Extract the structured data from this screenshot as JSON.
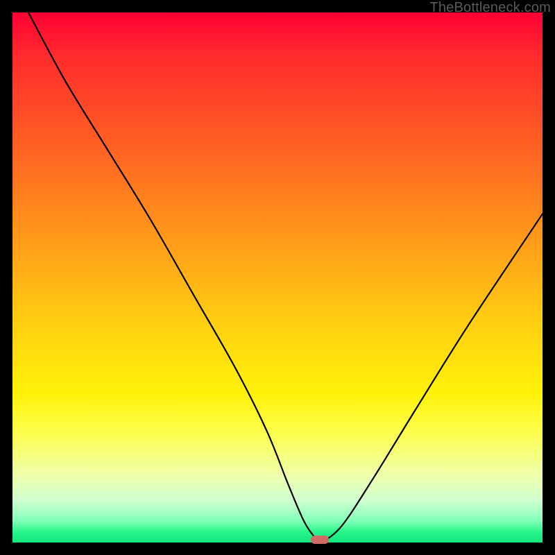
{
  "watermark": "TheBottleneck.com",
  "chart_data": {
    "type": "line",
    "title": "",
    "xlabel": "",
    "ylabel": "",
    "xlim": [
      0,
      100
    ],
    "ylim": [
      0,
      100
    ],
    "background": "rainbow-gradient",
    "series": [
      {
        "name": "bottleneck-curve",
        "x": [
          3,
          10,
          18,
          26,
          34,
          42,
          48,
          52,
          55,
          57,
          58,
          62,
          68,
          76,
          86,
          100
        ],
        "values": [
          100,
          87,
          74,
          61,
          47,
          33,
          21,
          11,
          4,
          1,
          0,
          3,
          12,
          25,
          41,
          62
        ]
      }
    ],
    "marker": {
      "x": 58,
      "y": 0,
      "color": "#cf6c68"
    }
  }
}
